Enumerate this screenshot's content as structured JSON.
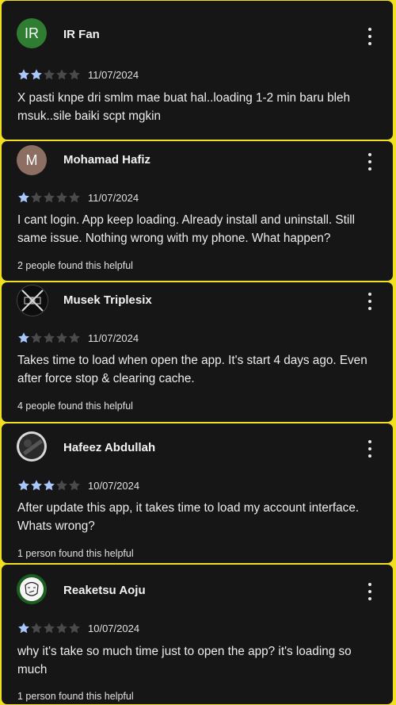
{
  "reviews": [
    {
      "name": "IR Fan",
      "avatar_text": "IR",
      "avatar_color": "#2e7d32",
      "rating": 2,
      "date": "11/07/2024",
      "text": "X pasti knpe dri smlm mae buat hal..loading 1-2 min baru bleh msuk..sile baiki scpt mgkin",
      "helpful": ""
    },
    {
      "name": "Mohamad Hafiz",
      "avatar_text": "M",
      "avatar_color": "#8d6e63",
      "rating": 1,
      "date": "11/07/2024",
      "text": "I cant login. App keep loading. Already install and uninstall. Still same issue. Nothing wrong with my phone. What happen?",
      "helpful": "2 people found this helpful"
    },
    {
      "name": "Musek Triplesix",
      "avatar_text": "",
      "avatar_color": "#111111",
      "rating": 1,
      "date": "11/07/2024",
      "text": "Takes time to load when open the app. It's start 4 days ago. Even after force stop & clearing cache.",
      "helpful": "4 people found this helpful"
    },
    {
      "name": "Hafeez Abdullah",
      "avatar_text": "",
      "avatar_color": "#3a3a3a",
      "rating": 3,
      "date": "10/07/2024",
      "text": "After update this app, it takes time to load my account interface. Whats wrong?",
      "helpful": "1 person found this helpful"
    },
    {
      "name": "Reaketsu Aoju",
      "avatar_text": "",
      "avatar_color": "#f2f2f2",
      "rating": 1,
      "date": "10/07/2024",
      "text": "why it's take so much time just to open the app? it's loading so much",
      "helpful": "1 person found this helpful"
    }
  ],
  "colors": {
    "star_filled": "#a8c7fa",
    "star_empty": "#4a4a4a",
    "card_bg": "#161616",
    "border": "#f0e020"
  }
}
